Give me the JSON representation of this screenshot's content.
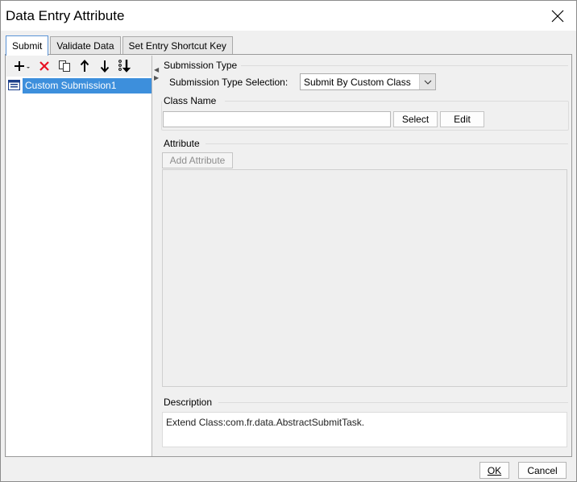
{
  "window": {
    "title": "Data Entry Attribute"
  },
  "tabs": [
    {
      "label": "Submit",
      "active": true
    },
    {
      "label": "Validate Data",
      "active": false
    },
    {
      "label": "Set Entry Shortcut Key",
      "active": false
    }
  ],
  "toolbar": {
    "icons": [
      "add-icon",
      "delete-icon",
      "copy-icon",
      "move-up-icon",
      "move-down-icon",
      "move-to-bottom-icon"
    ]
  },
  "tree": {
    "items": [
      {
        "label": "Custom Submission1",
        "selected": true
      }
    ]
  },
  "submission": {
    "section_title": "Submission Type",
    "type_label": "Submission Type Selection:",
    "type_value": "Submit By Custom Class"
  },
  "class_name": {
    "section_title": "Class Name",
    "value": "",
    "select_label": "Select",
    "edit_label": "Edit"
  },
  "attribute": {
    "section_title": "Attribute",
    "add_label": "Add Attribute"
  },
  "description": {
    "section_title": "Description",
    "text": "Extend Class:com.fr.data.AbstractSubmitTask."
  },
  "footer": {
    "ok_label": "OK",
    "cancel_label": "Cancel"
  },
  "colors": {
    "accent": "#3d8fdc",
    "delete_icon": "#e81123",
    "active_tab_border": "#5a93d6"
  }
}
